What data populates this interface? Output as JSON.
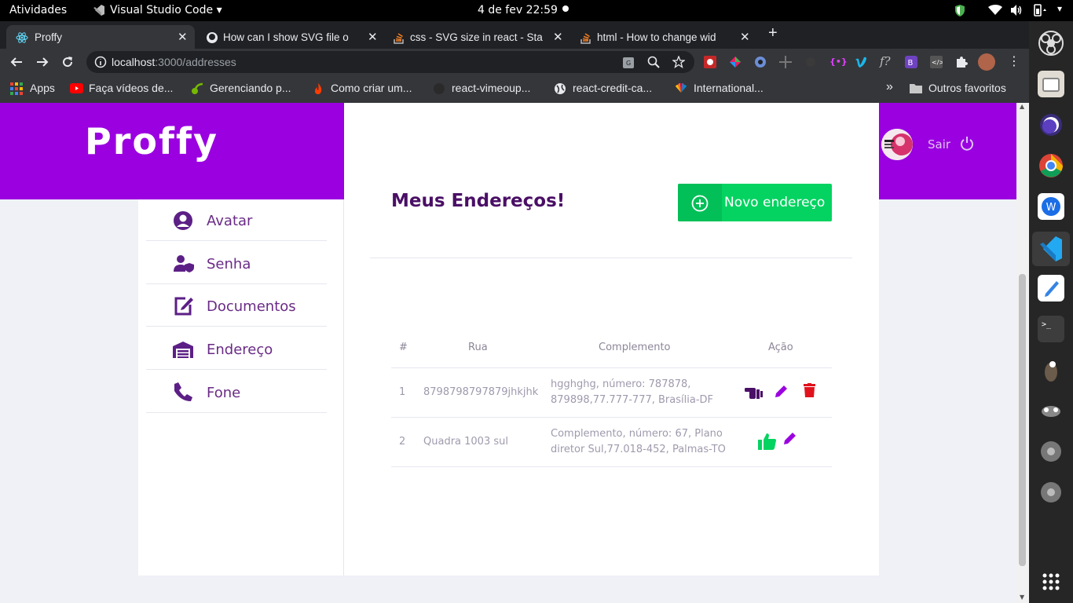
{
  "os": {
    "activities": "Atividades",
    "app_menu": "Visual Studio Code",
    "clock": "4 de fev  22:59"
  },
  "browser": {
    "tabs": [
      {
        "title": "Proffy",
        "active": true
      },
      {
        "title": "How can I show SVG file o",
        "active": false
      },
      {
        "title": "css - SVG size in react - Sta",
        "active": false
      },
      {
        "title": "html - How to change wid",
        "active": false
      }
    ],
    "new_tab": "+",
    "url_host": "localhost",
    "url_path": ":3000/addresses",
    "bookmarks": [
      "Apps",
      "Faça vídeos de...",
      "Gerenciando p...",
      "Como criar um...",
      "react-vimeoup...",
      "react-credit-ca...",
      "International..."
    ],
    "more_bookmarks": "»",
    "other_favorites": "Outros favoritos"
  },
  "app": {
    "logo": "Proffy",
    "logout": "Sair",
    "page_title": "Meus Endereços!",
    "new_address_button": "Novo endereço",
    "menu": [
      {
        "label": "Avatar",
        "icon": "user-circle-icon"
      },
      {
        "label": "Senha",
        "icon": "user-shield-icon"
      },
      {
        "label": "Documentos",
        "icon": "edit-document-icon"
      },
      {
        "label": "Endereço",
        "icon": "warehouse-icon"
      },
      {
        "label": "Fone",
        "icon": "phone-icon"
      }
    ],
    "table": {
      "headers": [
        "#",
        "Rua",
        "Complemento",
        "Ação"
      ],
      "rows": [
        {
          "num": "1",
          "rua": "8798798797879jhkjhk",
          "complemento_l1": "hgghghg, número: 787878,",
          "complemento_l2": "879898,77.777-777, Brasília-DF",
          "main_icon": "hand-point-left-icon"
        },
        {
          "num": "2",
          "rua": "Quadra 1003 sul",
          "complemento_l1": "Complemento, número: 67, Plano",
          "complemento_l2": "diretor Sul,77.018-452, Palmas-TO",
          "main_icon": "thumbs-up-icon"
        }
      ]
    },
    "colors": {
      "brand": "#9a00e0",
      "title": "#4a0f66",
      "green": "#04d361",
      "red": "#e0121c",
      "menu_text": "#6a2b86"
    }
  }
}
